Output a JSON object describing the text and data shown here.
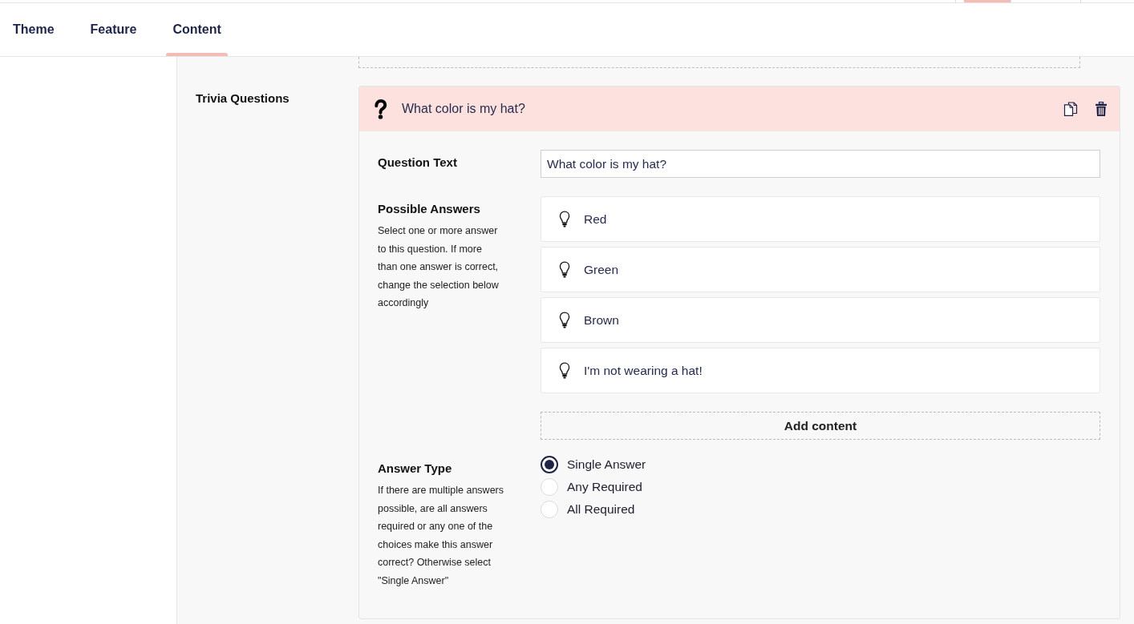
{
  "top_tabs": [
    {
      "selected": true
    },
    {
      "selected": false
    }
  ],
  "tabs": [
    {
      "label": "Theme",
      "selected": false
    },
    {
      "label": "Feature",
      "selected": false
    },
    {
      "label": "Content",
      "selected": true
    }
  ],
  "trivia_questions": {
    "label": "Trivia Questions",
    "questions": [
      {
        "title": "What color is my hat?",
        "expanded": true,
        "question_text": {
          "label": "Question Text",
          "value": "What color is my hat?"
        },
        "possible_answers": {
          "label": "Possible Answers",
          "help": "Select one or more answer to this question. If more than one answer is correct, change the selection below accordingly",
          "answers": [
            {
              "text": "Red"
            },
            {
              "text": "Green"
            },
            {
              "text": "Brown"
            },
            {
              "text": "I'm not wearing a hat!"
            }
          ],
          "add_button": "Add content"
        },
        "answer_type": {
          "label": "Answer Type",
          "help": "If there are multiple answers possible, are all answers required or any one of the choices make this answer correct? Otherwise select \"Single Answer\"",
          "options": [
            {
              "label": "Single Answer",
              "selected": true
            },
            {
              "label": "Any Required",
              "selected": false
            },
            {
              "label": "All Required",
              "selected": false
            }
          ]
        }
      }
    ]
  }
}
